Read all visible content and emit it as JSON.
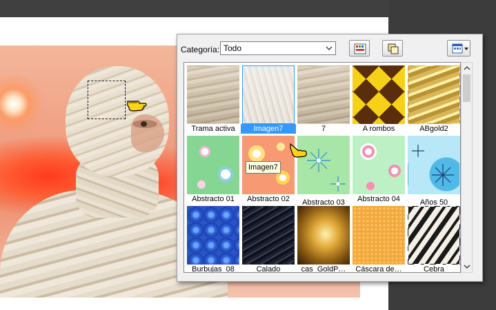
{
  "panel": {
    "category_label": "Categoría:",
    "category_value": "Todo",
    "tooltip": "Imagen7",
    "colors": {
      "selection": "#3399ff",
      "tooltip_bg": "#ffffe1"
    },
    "toolbar_icons": [
      "palette-icon",
      "copy-pages-icon",
      "view-mode-icon"
    ]
  },
  "tiles": [
    {
      "label": "Trama activa",
      "texture": "cloth"
    },
    {
      "label": "Imagen7",
      "texture": "cloth-light",
      "selected": true
    },
    {
      "label": "7",
      "texture": "cloth"
    },
    {
      "label": "A rombos",
      "texture": "diamonds"
    },
    {
      "label": "ABgold2",
      "texture": "gold"
    },
    {
      "label": "Abstracto 01",
      "texture": "abstract"
    },
    {
      "label": "Abstracto 02",
      "texture": "abstract"
    },
    {
      "label": "Abstracto 03",
      "texture": "abstract"
    },
    {
      "label": "Abstracto 04",
      "texture": "abstract"
    },
    {
      "label": "Años 50",
      "texture": "fifties"
    },
    {
      "label": "Burbujas_08",
      "texture": "bubbles"
    },
    {
      "label": "Calado",
      "texture": "dark-lines"
    },
    {
      "label": "cas_GoldP…",
      "texture": "gold-glow"
    },
    {
      "label": "Cáscara de…",
      "texture": "orange-peel"
    },
    {
      "label": "Cebra",
      "texture": "zebra"
    }
  ]
}
